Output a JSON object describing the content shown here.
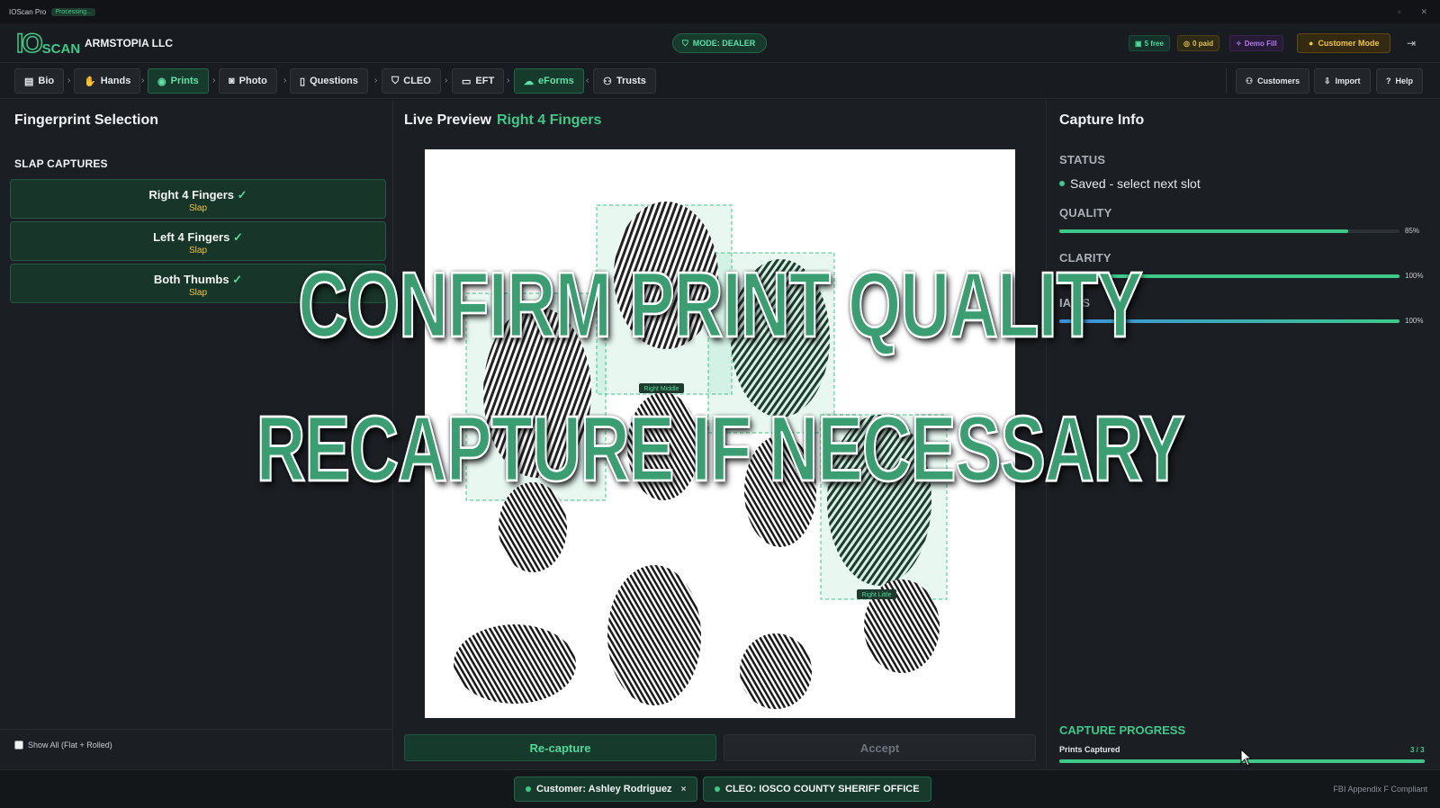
{
  "titlebar": {
    "app": "IOScan Pro",
    "status": "Processing..."
  },
  "header": {
    "logo_io": "IO",
    "logo_scan": "SCAN",
    "company": "ARMSTOPIA LLC",
    "mode": "MODE: DEALER",
    "free_chip": "5 free",
    "paid_chip": "0 paid",
    "demo_chip": "Demo Fill",
    "customer_mode": "Customer Mode"
  },
  "nav": {
    "tabs": [
      "Bio",
      "Hands",
      "Prints",
      "Photo",
      "Questions",
      "CLEO",
      "EFT",
      "eForms",
      "Trusts"
    ],
    "right": [
      "Customers",
      "Import",
      "Help"
    ]
  },
  "left": {
    "title": "Fingerprint Selection",
    "section": "SLAP CAPTURES",
    "slots": [
      {
        "name": "Right 4 Fingers",
        "check": "✓",
        "sub": "Slap"
      },
      {
        "name": "Left 4 Fingers",
        "check": "✓",
        "sub": "Slap"
      },
      {
        "name": "Both Thumbs",
        "check": "✓",
        "sub": "Slap"
      }
    ],
    "show_all": "Show All (Flat + Rolled)"
  },
  "center": {
    "title": "Live Preview",
    "subtitle": "Right 4 Fingers",
    "finger_labels": {
      "middle": "Right Middle",
      "little": "Right Little"
    },
    "recapture": "Re-capture",
    "accept": "Accept"
  },
  "right": {
    "title": "Capture Info",
    "status_label": "STATUS",
    "status_value": "Saved - select next slot",
    "quality_label": "QUALITY",
    "quality_pct": "85%",
    "quality_value": 0.85,
    "clarity_label": "CLARITY",
    "clarity_pct": "100%",
    "clarity_value": 1.0,
    "iafis_label": "IAFIS",
    "iafis_pct": "100%",
    "iafis_value": 1.0,
    "progress_title": "CAPTURE PROGRESS",
    "progress_label": "Prints Captured",
    "progress_count": "3 / 3",
    "progress_value": 1.0
  },
  "footer": {
    "customer": "Customer: Ashley Rodriguez",
    "close": "×",
    "cleo": "CLEO: IOSCO COUNTY SHERIFF OFFICE",
    "compliance": "FBI Appendix F Compliant"
  },
  "overlay": {
    "line1": "CONFIRM PRINT QUALITY",
    "line2": "RECAPTURE IF NECESSARY"
  },
  "colors": {
    "accent": "#3ec98a",
    "warning": "#f0c53a",
    "iafis": "#3b8fe0"
  }
}
